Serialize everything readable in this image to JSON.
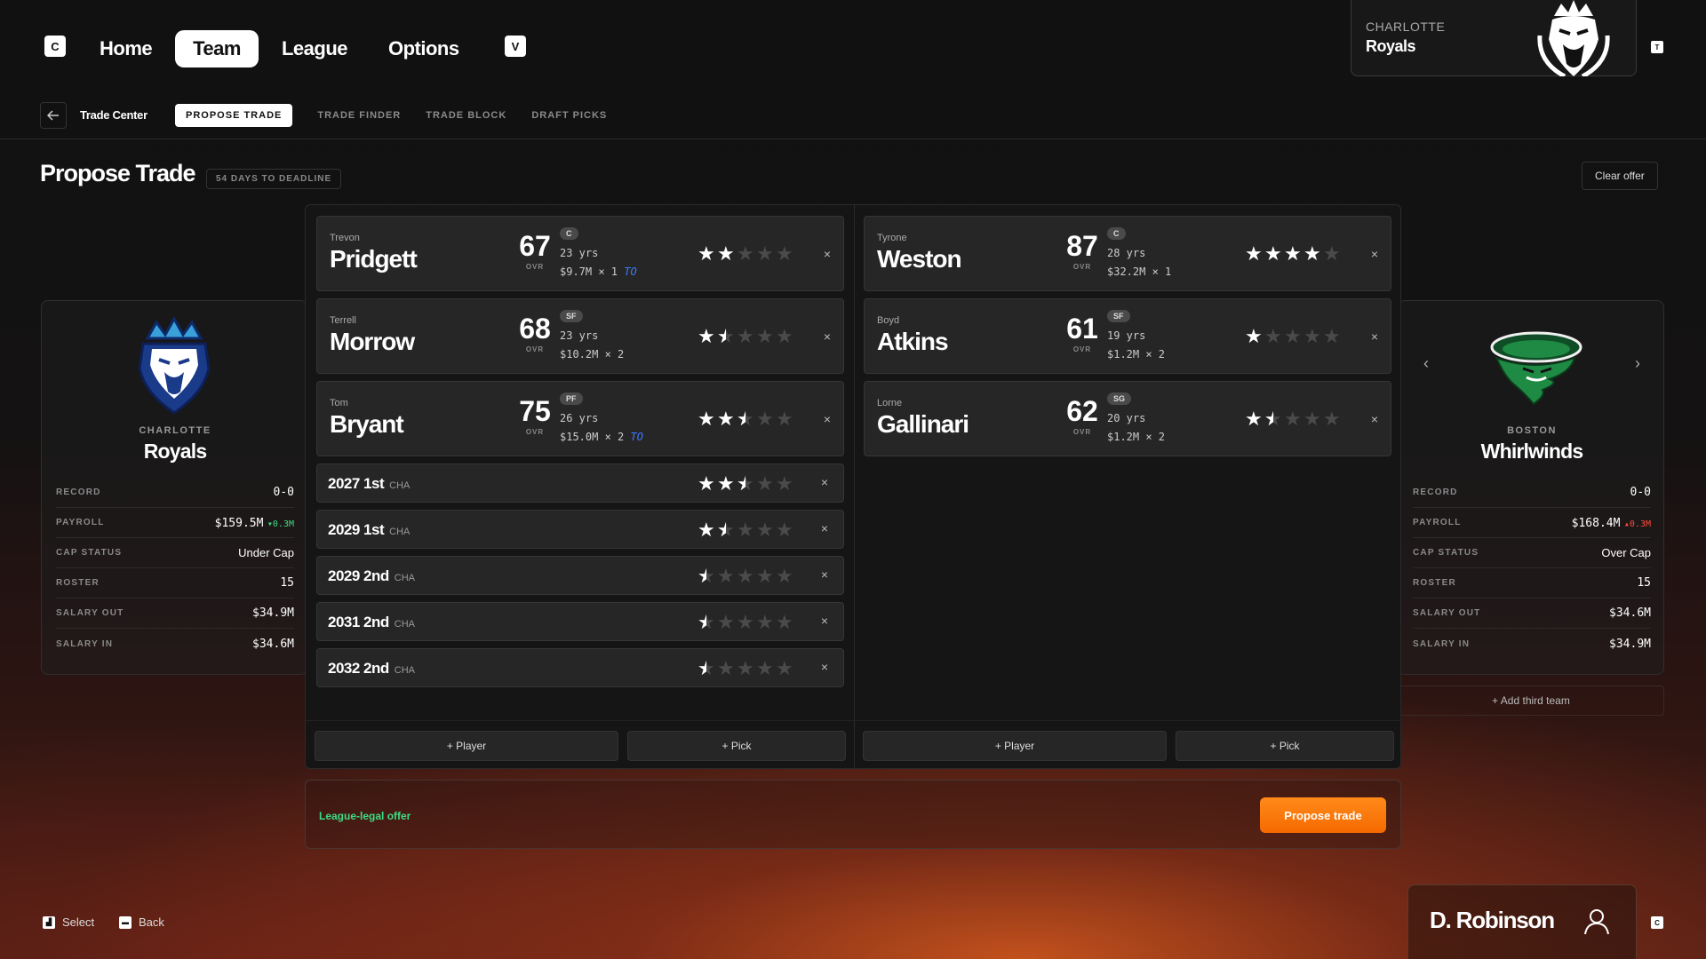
{
  "nav": {
    "left_key": "C",
    "right_key": "V",
    "items": [
      {
        "label": "Home",
        "active": false
      },
      {
        "label": "Team",
        "active": true
      },
      {
        "label": "League",
        "active": false
      },
      {
        "label": "Options",
        "active": false
      }
    ]
  },
  "team_card": {
    "city": "CHARLOTTE",
    "name": "Royals",
    "key": "T"
  },
  "subnav": {
    "back_icon": "arrow-left-icon",
    "section": "Trade Center",
    "tabs": [
      {
        "label": "PROPOSE TRADE",
        "active": true
      },
      {
        "label": "TRADE FINDER",
        "active": false
      },
      {
        "label": "TRADE BLOCK",
        "active": false
      },
      {
        "label": "DRAFT PICKS",
        "active": false
      }
    ]
  },
  "page": {
    "title": "Propose Trade",
    "deadline_badge": "54 DAYS TO DEADLINE",
    "clear_offer": "Clear offer"
  },
  "left_team": {
    "city": "CHARLOTTE",
    "name": "Royals",
    "stats": [
      {
        "label": "RECORD",
        "value": "0-0",
        "mono": true
      },
      {
        "label": "PAYROLL",
        "value": "$159.5M",
        "mono": true,
        "delta": "▾0.3M",
        "delta_color": "#3ddc84"
      },
      {
        "label": "CAP STATUS",
        "value": "Under Cap",
        "mono": false
      },
      {
        "label": "ROSTER",
        "value": "15",
        "mono": true
      },
      {
        "label": "SALARY OUT",
        "value": "$34.9M",
        "mono": true
      },
      {
        "label": "SALARY IN",
        "value": "$34.6M",
        "mono": true
      }
    ]
  },
  "right_team": {
    "city": "BOSTON",
    "name": "Whirlwinds",
    "prev_icon": "‹",
    "next_icon": "›",
    "stats": [
      {
        "label": "RECORD",
        "value": "0-0",
        "mono": true
      },
      {
        "label": "PAYROLL",
        "value": "$168.4M",
        "mono": true,
        "delta": "▴0.3M",
        "delta_color": "#ff4a3d"
      },
      {
        "label": "CAP STATUS",
        "value": "Over Cap",
        "mono": false
      },
      {
        "label": "ROSTER",
        "value": "15",
        "mono": true
      },
      {
        "label": "SALARY OUT",
        "value": "$34.6M",
        "mono": true
      },
      {
        "label": "SALARY IN",
        "value": "$34.9M",
        "mono": true
      }
    ],
    "add_third_team": "+ Add third team"
  },
  "left_assets": {
    "players": [
      {
        "first": "Trevon",
        "last": "Pridgett",
        "ovr": "67",
        "ovr_label": "OVR",
        "pos": "C",
        "age": "23 yrs",
        "contract": "$9.7M × 1",
        "option": "TO",
        "stars": 2
      },
      {
        "first": "Terrell",
        "last": "Morrow",
        "ovr": "68",
        "ovr_label": "OVR",
        "pos": "SF",
        "age": "23 yrs",
        "contract": "$10.2M × 2",
        "option": "",
        "stars": 1.5
      },
      {
        "first": "Tom",
        "last": "Bryant",
        "ovr": "75",
        "ovr_label": "OVR",
        "pos": "PF",
        "age": "26 yrs",
        "contract": "$15.0M × 2",
        "option": "TO",
        "stars": 2.5
      }
    ],
    "picks": [
      {
        "name": "2027 1st",
        "team": "CHA",
        "stars": 2.5
      },
      {
        "name": "2029 1st",
        "team": "CHA",
        "stars": 1.5
      },
      {
        "name": "2029 2nd",
        "team": "CHA",
        "stars": 0.5
      },
      {
        "name": "2031 2nd",
        "team": "CHA",
        "stars": 0.5
      },
      {
        "name": "2032 2nd",
        "team": "CHA",
        "stars": 0.5
      }
    ],
    "add_player": "+ Player",
    "add_pick": "+ Pick"
  },
  "right_assets": {
    "players": [
      {
        "first": "Tyrone",
        "last": "Weston",
        "ovr": "87",
        "ovr_label": "OVR",
        "pos": "C",
        "age": "28 yrs",
        "contract": "$32.2M × 1",
        "option": "",
        "stars": 4
      },
      {
        "first": "Boyd",
        "last": "Atkins",
        "ovr": "61",
        "ovr_label": "OVR",
        "pos": "SF",
        "age": "19 yrs",
        "contract": "$1.2M × 2",
        "option": "",
        "stars": 1
      },
      {
        "first": "Lorne",
        "last": "Gallinari",
        "ovr": "62",
        "ovr_label": "OVR",
        "pos": "SG",
        "age": "20 yrs",
        "contract": "$1.2M × 2",
        "option": "",
        "stars": 1.5
      }
    ],
    "picks": [],
    "add_player": "+ Player",
    "add_pick": "+ Pick"
  },
  "footer": {
    "status": "League-legal offer",
    "status_color": "#3ddc84",
    "propose": "Propose trade"
  },
  "hints": [
    {
      "key": "select",
      "label": "Select"
    },
    {
      "key": "back",
      "label": "Back"
    }
  ],
  "user": {
    "name": "D. Robinson",
    "icon": "user-icon",
    "key": "C"
  },
  "remove_icon": "×"
}
